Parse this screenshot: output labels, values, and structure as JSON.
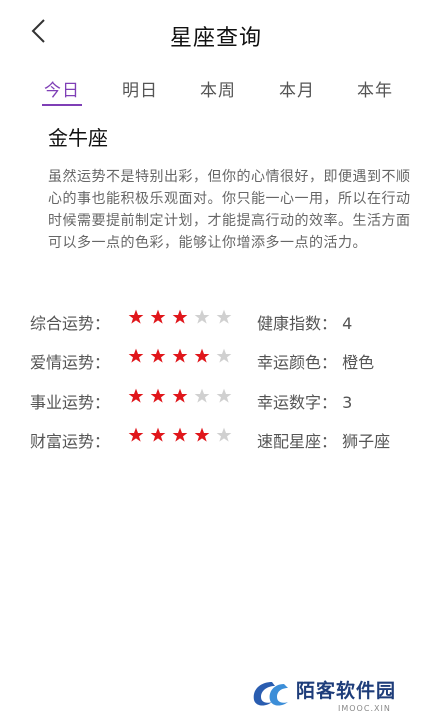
{
  "header": {
    "title": "星座查询",
    "back_icon": "chevron-left-icon"
  },
  "tabs": [
    {
      "label": "今日",
      "active": true
    },
    {
      "label": "明日",
      "active": false
    },
    {
      "label": "本周",
      "active": false
    },
    {
      "label": "本月",
      "active": false
    },
    {
      "label": "本年",
      "active": false
    }
  ],
  "sign": "金牛座",
  "description": "虽然运势不是特别出彩，但你的心情很好，即便遇到不顺心的事也能积极乐观面对。你只能一心一用，所以在行动时候需要提前制定计划，才能提高行动的效率。生活方面可以多一点的色彩，能够让你增添多一点的活力。",
  "fortunes": [
    {
      "label": "综合运势：",
      "stars": 3,
      "max": 5
    },
    {
      "label": "爱情运势：",
      "stars": 4,
      "max": 5
    },
    {
      "label": "事业运势：",
      "stars": 3,
      "max": 5
    },
    {
      "label": "财富运势：",
      "stars": 4,
      "max": 5
    }
  ],
  "info": [
    {
      "text": "健康指数：  4"
    },
    {
      "text": "幸运颜色：  橙色"
    },
    {
      "text": "幸运数字：  3"
    },
    {
      "text": "速配星座：  狮子座"
    }
  ],
  "colors": {
    "accent": "#7f3fb6",
    "star_on": "#e0161b",
    "star_off": "#d0d0d0"
  },
  "watermark": {
    "name": "陌客软件园",
    "sub": "IMOOC.XIN"
  }
}
